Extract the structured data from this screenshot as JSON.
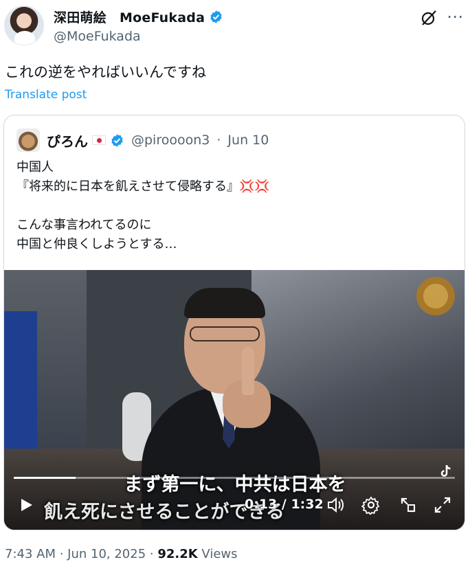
{
  "author": {
    "display_name": "深田萌絵　MoeFukada",
    "handle": "@MoeFukada",
    "verified": true
  },
  "post": {
    "text": "これの逆をやればいいんですね",
    "translate_label": "Translate post"
  },
  "quoted": {
    "name": "ぴろん",
    "handle": "@piroooon3",
    "date": "Jun 10",
    "line1": "中国人",
    "line2": "『将来的に日本を飢えさせて侵略する』",
    "anger_emoji": "💢💢",
    "line3": "こんな事言われてるのに",
    "line4": "中国と仲良くしようとする…"
  },
  "video": {
    "subtitle_line1": "まず第一に、中共は日本を",
    "subtitle_line2": "飢え死にさせることができる",
    "current_time": "0:13",
    "separator": " / ",
    "duration": "1:32",
    "progress_fraction": 0.14
  },
  "footer": {
    "time_date": "7:43 AM · Jun 10, 2025 · ",
    "views_count": "92.2K",
    "views_label": " Views"
  },
  "colors": {
    "link": "#1d9bf0",
    "secondary_text": "#536471",
    "verified": "#1d9bf0"
  }
}
